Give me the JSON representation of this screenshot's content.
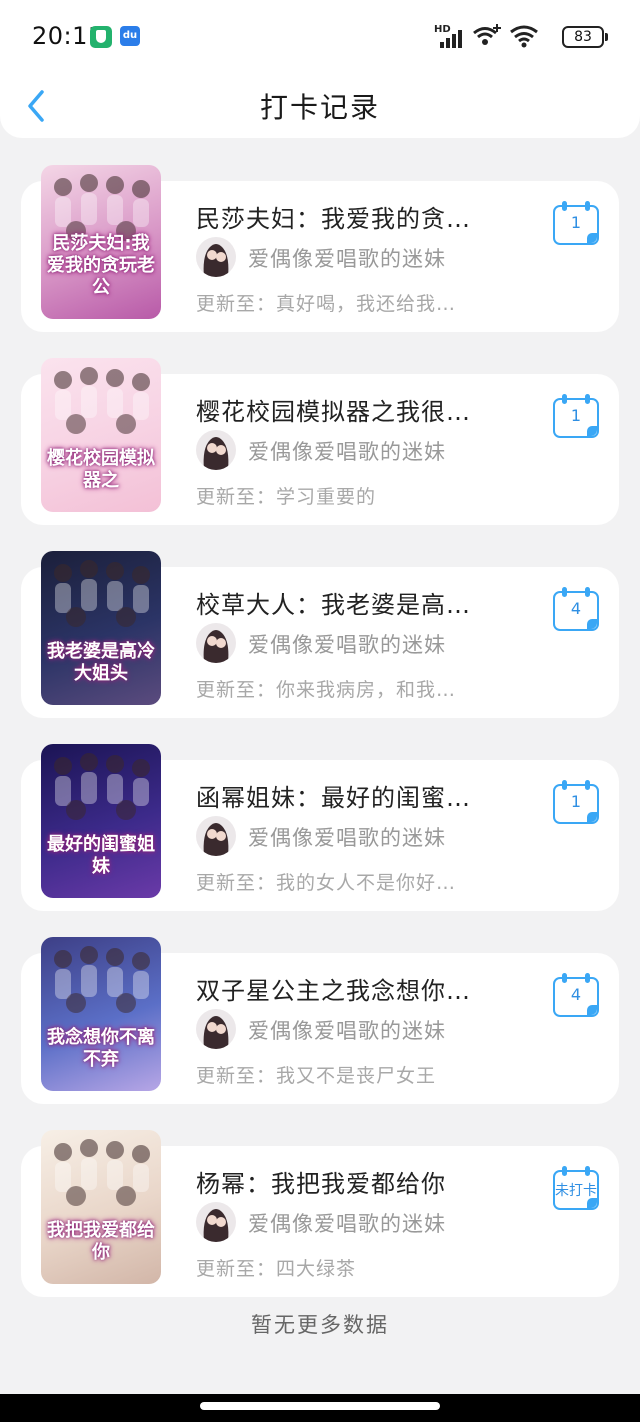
{
  "status_bar": {
    "time": "20:11",
    "network": "HD",
    "battery": "83"
  },
  "header": {
    "title": "打卡记录",
    "back_icon": "chevron-left-icon"
  },
  "books": [
    {
      "title": "民莎夫妇：我爱我的贪…",
      "author": "爱偶像爱唱歌的迷妹",
      "update": "更新至：真好喝，我还给我…",
      "checkin": "1",
      "cover_text": "民莎夫妇:我爱我的贪玩老公",
      "cover_colors": [
        "#f4d6e6",
        "#d896c6",
        "#b85aa8"
      ]
    },
    {
      "title": "樱花校园模拟器之我很…",
      "author": "爱偶像爱唱歌的迷妹",
      "update": "更新至：学习重要的",
      "checkin": "1",
      "cover_text": "樱花校园模拟器之",
      "cover_colors": [
        "#fbe3ee",
        "#f7d2e3",
        "#f3c0d6"
      ]
    },
    {
      "title": "校草大人：我老婆是高…",
      "author": "爱偶像爱唱歌的迷妹",
      "update": "更新至：你来我病房，和我…",
      "checkin": "4",
      "cover_text": "我老婆是高冷大姐头",
      "cover_colors": [
        "#1b1f3a",
        "#2b3466",
        "#5b4b7e"
      ]
    },
    {
      "title": "函幂姐妹：最好的闺蜜…",
      "author": "爱偶像爱唱歌的迷妹",
      "update": "更新至：我的女人不是你好…",
      "checkin": "1",
      "cover_text": "最好的闺蜜姐妹",
      "cover_colors": [
        "#1b1454",
        "#3c2a8a",
        "#6a3aa8"
      ]
    },
    {
      "title": "双子星公主之我念想你…",
      "author": "爱偶像爱唱歌的迷妹",
      "update": "更新至：我又不是丧尸女王",
      "checkin": "4",
      "cover_text": "我念想你不离不弃",
      "cover_colors": [
        "#3d3f86",
        "#5b6fc7",
        "#b7a6e6"
      ]
    },
    {
      "title": "杨幂：我把我爱都给你",
      "author": "爱偶像爱唱歌的迷妹",
      "update": "更新至：四大绿茶",
      "checkin": "未打卡",
      "cover_text": "我把我爱都给你",
      "cover_colors": [
        "#f7efe6",
        "#e9d6c9",
        "#d2b6a8"
      ]
    }
  ],
  "footer": {
    "note": "暂无更多数据"
  },
  "colors": {
    "accent": "#3aa7f5",
    "background": "#f2f2f3"
  }
}
